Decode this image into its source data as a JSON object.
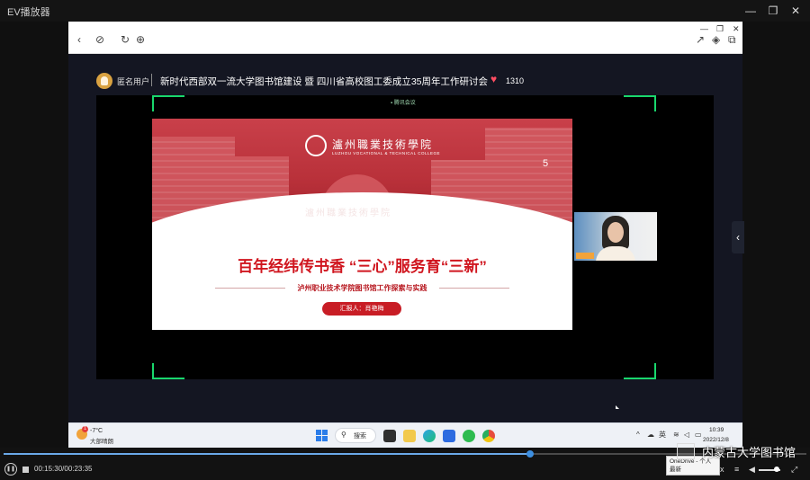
{
  "app": {
    "title": "EV播放器",
    "window_controls": {
      "minimize": "—",
      "restore": "❐",
      "close": "✕"
    }
  },
  "browser": {
    "nav_icons": [
      "back-icon",
      "link-icon",
      "refresh-icon",
      "globe-icon"
    ],
    "tool_icons": [
      "share-icon",
      "cube-icon",
      "copy-icon"
    ],
    "mini_controls": {
      "minimize": "—",
      "restore": "❐",
      "close": "✕"
    }
  },
  "live": {
    "user_name": "匿名用户",
    "title": "新时代西部双一流大学图书馆建设 暨 四川省高校图工委成立35周年工作研讨会",
    "likes": "1310",
    "heart_color": "#ff4d62",
    "top_label": "▪ 腾讯会议"
  },
  "slide": {
    "college_cn": "瀘州職業技術學院",
    "college_en": "LUZHOU VOCATIONAL & TECHNICAL COLLEGE",
    "sign_text": "瀘州職業技術學院",
    "building_number": "5",
    "main_title": "百年经纬传书香 “三心”服务育“三新”",
    "sub_title": "泸州职业技术学院图书馆工作探索与实践",
    "reporter": "汇报人：肖艳梅",
    "accent_color": "#d0161f"
  },
  "taskbar": {
    "weather_badge": "1",
    "temperature": "-7°C",
    "condition": "大部晴朗",
    "search_label": "搜索",
    "tray_lang": "英",
    "time": "10:39",
    "date": "2022/12/8"
  },
  "player": {
    "progress_fraction": 0.656,
    "time_readout": "00:15:30/00:23:35",
    "speed_label": "x",
    "volume_fraction": 0.7,
    "play_state": "pause-icon"
  },
  "tooltip": {
    "line1": "OneDrive - 个人",
    "line2": "最新"
  },
  "watermark": {
    "text": "内蒙古大学图书馆"
  }
}
